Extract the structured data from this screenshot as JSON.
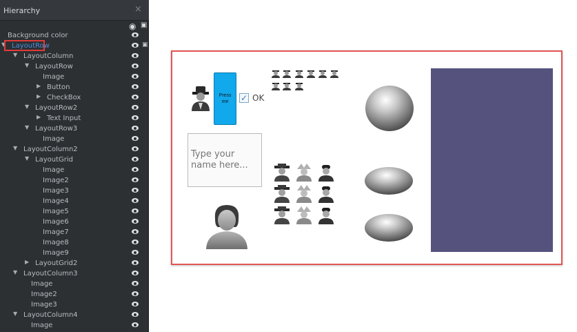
{
  "hierarchy": {
    "title": "Hierarchy",
    "close_glyph": "×",
    "head_eye_glyph": "👁",
    "head_lock_glyph": "🔒",
    "items": [
      {
        "label": "Background color",
        "arrow": "",
        "depth": 0,
        "lock": false,
        "selected": false
      },
      {
        "label": "LayoutRow",
        "arrow": "▼",
        "depth": 0,
        "lock": true,
        "selected": true
      },
      {
        "label": "LayoutColumn",
        "arrow": "▼",
        "depth": 1,
        "lock": false,
        "selected": false
      },
      {
        "label": "LayoutRow",
        "arrow": "▼",
        "depth": 2,
        "lock": false,
        "selected": false
      },
      {
        "label": "Image",
        "arrow": "",
        "depth": 3,
        "lock": false,
        "selected": false
      },
      {
        "label": "Button",
        "arrow": "▶",
        "depth": 3,
        "lock": false,
        "selected": false
      },
      {
        "label": "CheckBox",
        "arrow": "▶",
        "depth": 3,
        "lock": false,
        "selected": false
      },
      {
        "label": "LayoutRow2",
        "arrow": "▼",
        "depth": 2,
        "lock": false,
        "selected": false
      },
      {
        "label": "Text Input",
        "arrow": "▶",
        "depth": 3,
        "lock": false,
        "selected": false
      },
      {
        "label": "LayoutRow3",
        "arrow": "▼",
        "depth": 2,
        "lock": false,
        "selected": false
      },
      {
        "label": "Image",
        "arrow": "",
        "depth": 3,
        "lock": false,
        "selected": false
      },
      {
        "label": "LayoutColumn2",
        "arrow": "▼",
        "depth": 1,
        "lock": false,
        "selected": false
      },
      {
        "label": "LayoutGrid",
        "arrow": "▼",
        "depth": 2,
        "lock": false,
        "selected": false
      },
      {
        "label": "Image",
        "arrow": "",
        "depth": 3,
        "lock": false,
        "selected": false
      },
      {
        "label": "Image2",
        "arrow": "",
        "depth": 3,
        "lock": false,
        "selected": false
      },
      {
        "label": "Image3",
        "arrow": "",
        "depth": 3,
        "lock": false,
        "selected": false
      },
      {
        "label": "Image4",
        "arrow": "",
        "depth": 3,
        "lock": false,
        "selected": false
      },
      {
        "label": "Image5",
        "arrow": "",
        "depth": 3,
        "lock": false,
        "selected": false
      },
      {
        "label": "Image6",
        "arrow": "",
        "depth": 3,
        "lock": false,
        "selected": false
      },
      {
        "label": "Image7",
        "arrow": "",
        "depth": 3,
        "lock": false,
        "selected": false
      },
      {
        "label": "Image8",
        "arrow": "",
        "depth": 3,
        "lock": false,
        "selected": false
      },
      {
        "label": "Image9",
        "arrow": "",
        "depth": 3,
        "lock": false,
        "selected": false
      },
      {
        "label": "LayoutGrid2",
        "arrow": "▶",
        "depth": 2,
        "lock": false,
        "selected": false
      },
      {
        "label": "LayoutColumn3",
        "arrow": "▼",
        "depth": 1,
        "lock": false,
        "selected": false
      },
      {
        "label": "Image",
        "arrow": "",
        "depth": 2,
        "lock": false,
        "selected": false
      },
      {
        "label": "Image2",
        "arrow": "",
        "depth": 2,
        "lock": false,
        "selected": false
      },
      {
        "label": "Image3",
        "arrow": "",
        "depth": 2,
        "lock": false,
        "selected": false
      },
      {
        "label": "LayoutColumn4",
        "arrow": "▼",
        "depth": 1,
        "lock": false,
        "selected": false
      },
      {
        "label": "Image",
        "arrow": "",
        "depth": 2,
        "lock": false,
        "selected": false
      }
    ]
  },
  "preview": {
    "button_label": "Press me",
    "checkbox_label": "OK",
    "checkbox_checked": true,
    "checkbox_glyph": "✓",
    "text_input_placeholder": "Type your name here...",
    "colors": {
      "button": "#11a8ec",
      "panel_rect": "#55537e",
      "selection_outline": "#e35454"
    },
    "icons": {
      "character_small": "character-icon",
      "profile_large": "user-profile-icon",
      "sphere": "sphere-icon",
      "ellipsoid": "ellipsoid-icon"
    }
  }
}
